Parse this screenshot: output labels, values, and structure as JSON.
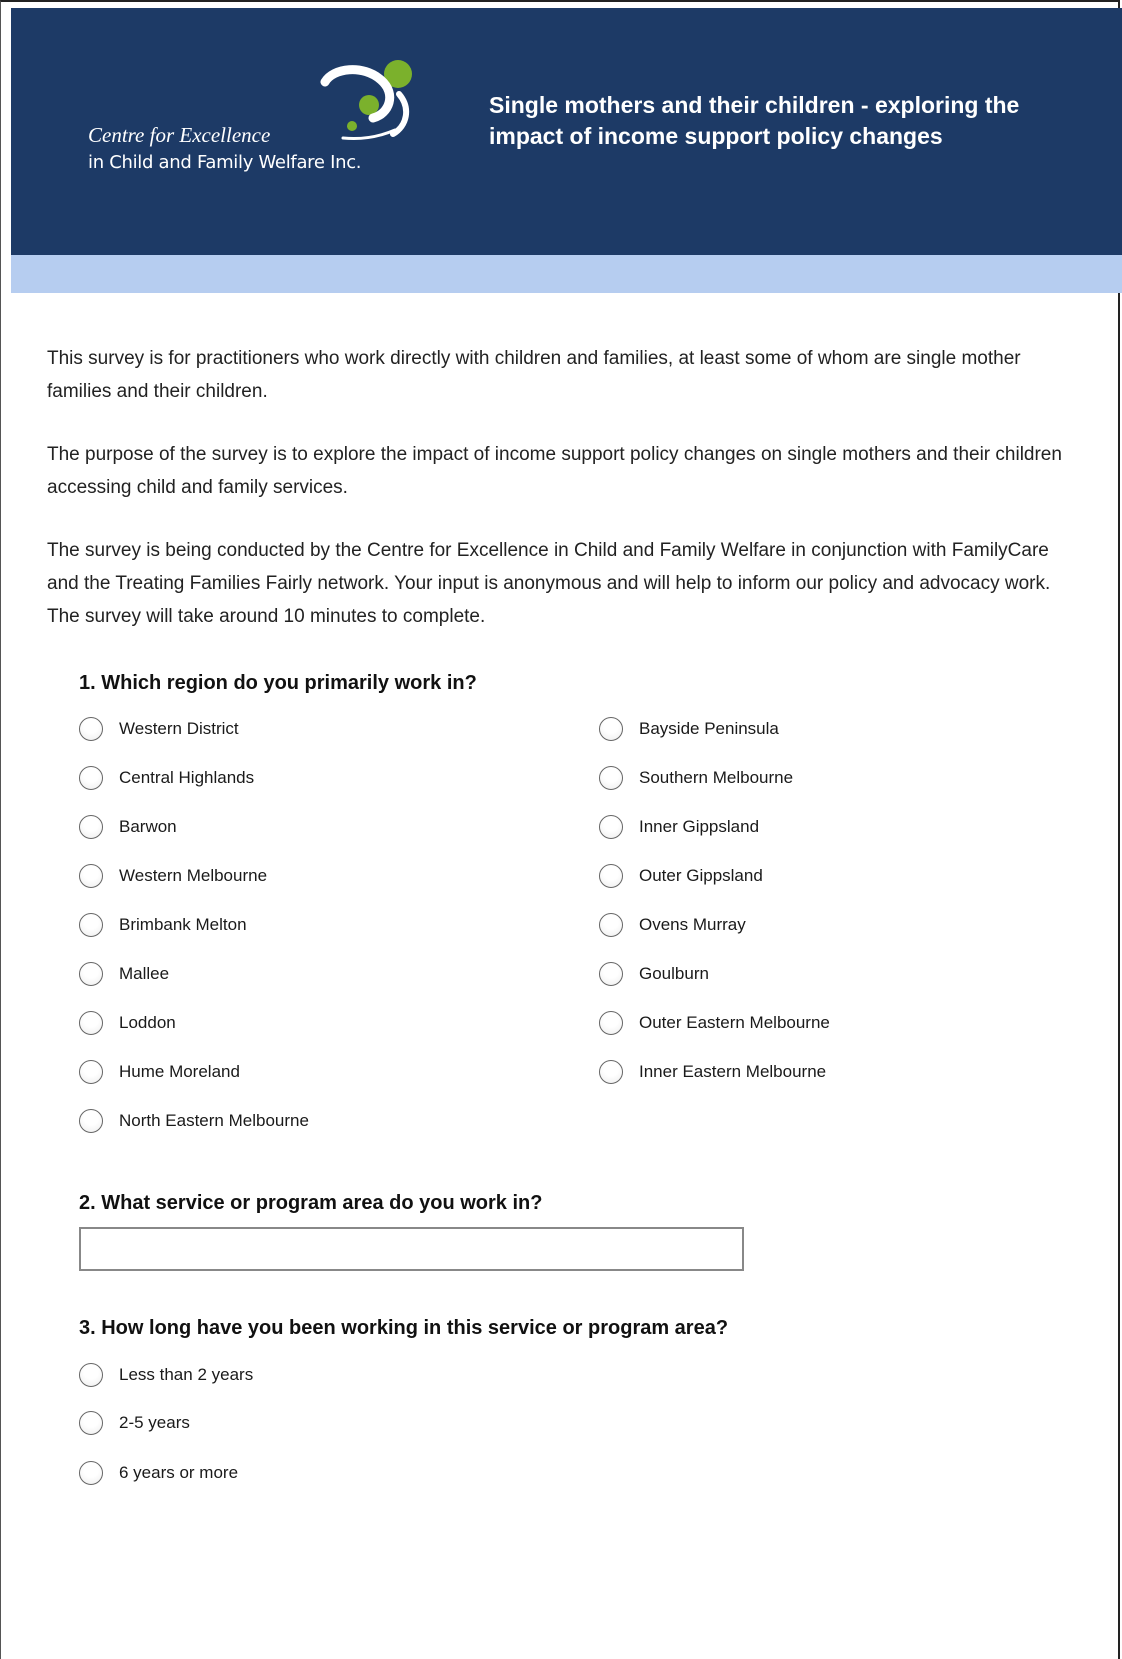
{
  "header": {
    "org_line1": "Centre for Excellence",
    "org_line2": "in Child and Family Welfare Inc.",
    "title": "Single mothers and their children - exploring the impact of income support policy changes",
    "colors": {
      "header_bg": "#1d3a66",
      "band": "#b6cdf0",
      "logo_green": "#7bb12c",
      "logo_white": "#ffffff"
    }
  },
  "intro": [
    "This survey is for practitioners who work directly with children and families, at least some of whom are single mother families and their children.",
    "The purpose of the survey is to explore the impact of income support policy changes on single mothers and their children accessing child and family services.",
    "The survey is being conducted by the Centre for Excellence in Child and Family Welfare in conjunction with FamilyCare and the Treating Families Fairly network. Your input is anonymous and will help to inform our policy and advocacy work. The survey will take around 10 minutes to complete."
  ],
  "q1": {
    "label": "1. Which region do you primarily work in?",
    "left_options": [
      "Western District",
      "Central Highlands",
      "Barwon",
      "Western Melbourne",
      "Brimbank Melton",
      "Mallee",
      "Loddon",
      "Hume Moreland",
      "North Eastern Melbourne"
    ],
    "right_options": [
      "Bayside Peninsula",
      "Southern Melbourne",
      "Inner Gippsland",
      "Outer Gippsland",
      "Ovens Murray",
      "Goulburn",
      "Outer Eastern Melbourne",
      "Inner Eastern Melbourne"
    ]
  },
  "q2": {
    "label": "2. What service or program area do you work in?",
    "value": ""
  },
  "q3": {
    "label": "3. How long have you been working in this service or program area?",
    "options": [
      "Less than 2 years",
      "2-5 years",
      "6 years or more"
    ]
  }
}
